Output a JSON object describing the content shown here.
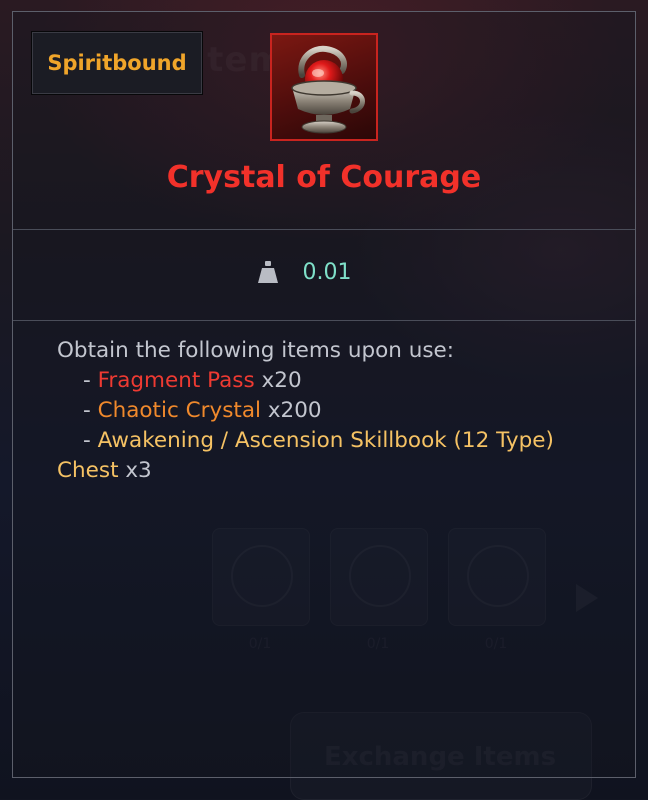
{
  "background": {
    "ghost_title": "& Item Info",
    "ghost_slot_counts": [
      "0/1",
      "0/1",
      "0/1"
    ],
    "ghost_button_label": "Exchange Items"
  },
  "tooltip": {
    "bound_label": "Spiritbound",
    "item_icon": "crystal-chalice-icon",
    "item_name": "Crystal of Courage",
    "weight_icon": "weight-icon",
    "weight_value": "0.01",
    "description_intro": "Obtain the following items upon use:",
    "rewards": [
      {
        "prefix": "- ",
        "name": "Fragment Pass",
        "qty": " x20",
        "color": "#ee3a32"
      },
      {
        "prefix": "- ",
        "name": "Chaotic Crystal",
        "qty": " x200",
        "color": "#f0892c"
      },
      {
        "prefix": "- ",
        "name": "Awakening / Ascension Skillbook (12 Type)",
        "name_wrap": "Chest",
        "qty": " x3",
        "color": "#f5c264"
      }
    ]
  },
  "colors": {
    "item_name": "#f2312a",
    "bound_label": "#f0a52a",
    "weight_value": "#7fe0c9",
    "icon_border": "#c9241f"
  }
}
